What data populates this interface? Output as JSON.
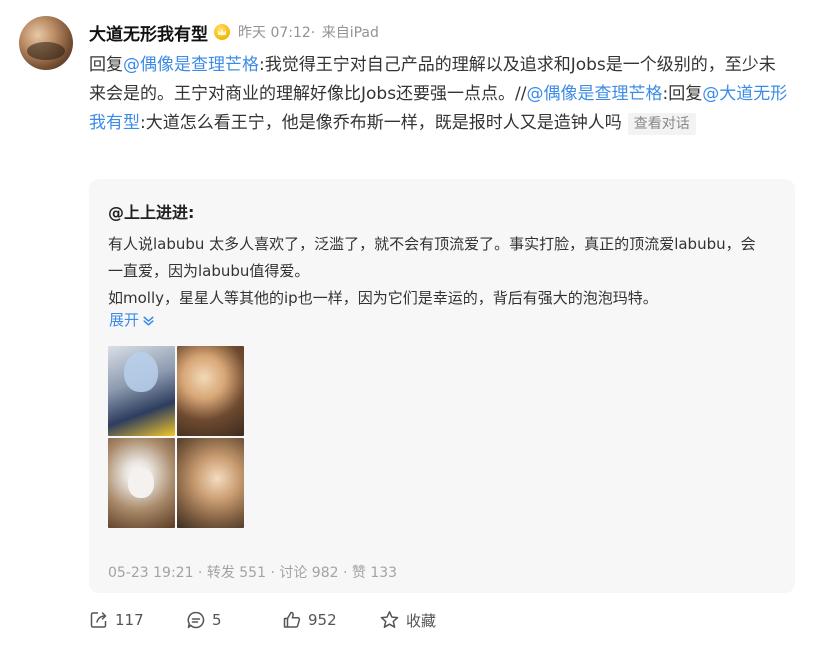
{
  "post": {
    "author": "大道无形我有型",
    "time": "昨天 07:12",
    "source": "来自iPad",
    "body": {
      "prefix": "回复",
      "mention1": "@偶像是查理芒格",
      "text1": ":我觉得王宁对自己产品的理解以及追求和Jobs是一个级别的，至少未来会是的。王宁对商业的理解好像比Jobs还要强一点点。//",
      "mention2": "@偶像是查理芒格",
      "text2": ":回复",
      "mention3": "@大道无形我有型",
      "text3": ":大道怎么看王宁，他是像乔布斯一样，既是报时人又是造钟人吗"
    },
    "view_conversation": "查看对话"
  },
  "quoted": {
    "author": "@上上进进",
    "author_suffix": ":",
    "line1": "有人说labubu 太多人喜欢了，泛滥了，就不会有顶流爱了。事实打脸，真正的顶流爱labubu，会一直爱，因为labubu值得爱。",
    "line2": "如molly，星星人等其他的ip也一样，因为它们是幸运的，背后有强大的泡泡玛特。",
    "expand": "展开",
    "footer": "05-23 19:21 · 转发 551 · 讨论 982 · 赞 133"
  },
  "actions": {
    "repost": "117",
    "comment": "5",
    "like": "952",
    "favorite": "收藏"
  },
  "icons": {
    "vip": "vip-crown-icon",
    "repost": "repost-icon",
    "comment": "comment-icon",
    "like": "like-icon",
    "favorite": "star-icon",
    "expand": "chevron-down-icon"
  },
  "colors": {
    "link": "#3c8ce7",
    "text": "#333333",
    "muted": "#939393",
    "quote_bg": "#f7f7f8"
  }
}
